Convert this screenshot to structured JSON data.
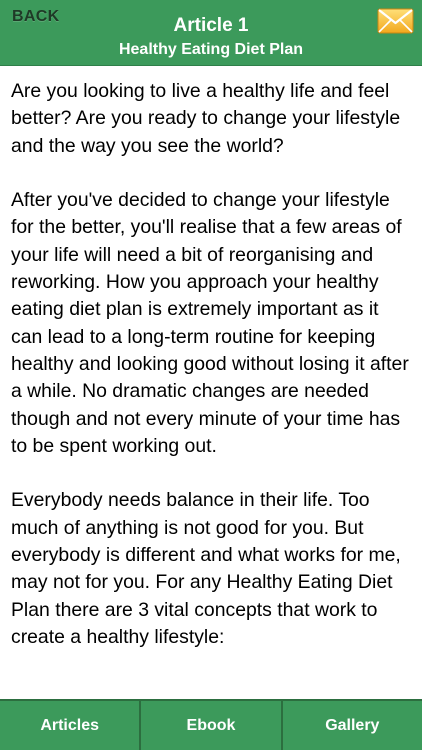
{
  "header": {
    "back_label": "BACK",
    "title": "Article 1",
    "subtitle": "Healthy Eating Diet Plan",
    "mail_icon": "mail-envelope-icon",
    "accent_color": "#3c9a5b"
  },
  "article": {
    "paragraphs": [
      "Are you looking to live a healthy life and feel better? Are you ready to change your lifestyle and the way you see the world?",
      "After you've decided to change your lifestyle for the better, you'll realise that a few areas of your life will need a bit of reorganising and reworking. How you approach your healthy eating diet plan is extremely important as it can lead to a long-term routine for keeping healthy and looking good without losing it after a while. No dramatic changes are needed though and not every minute of your time has to be spent working out.",
      "Everybody needs balance in their life. Too much of anything is not good for you. But everybody is different and what works for me, may not for you. For any Healthy Eating Diet Plan there are 3 vital concepts that work to create a healthy lifestyle:"
    ]
  },
  "tabs": [
    {
      "label": "Articles"
    },
    {
      "label": "Ebook"
    },
    {
      "label": "Gallery"
    }
  ]
}
